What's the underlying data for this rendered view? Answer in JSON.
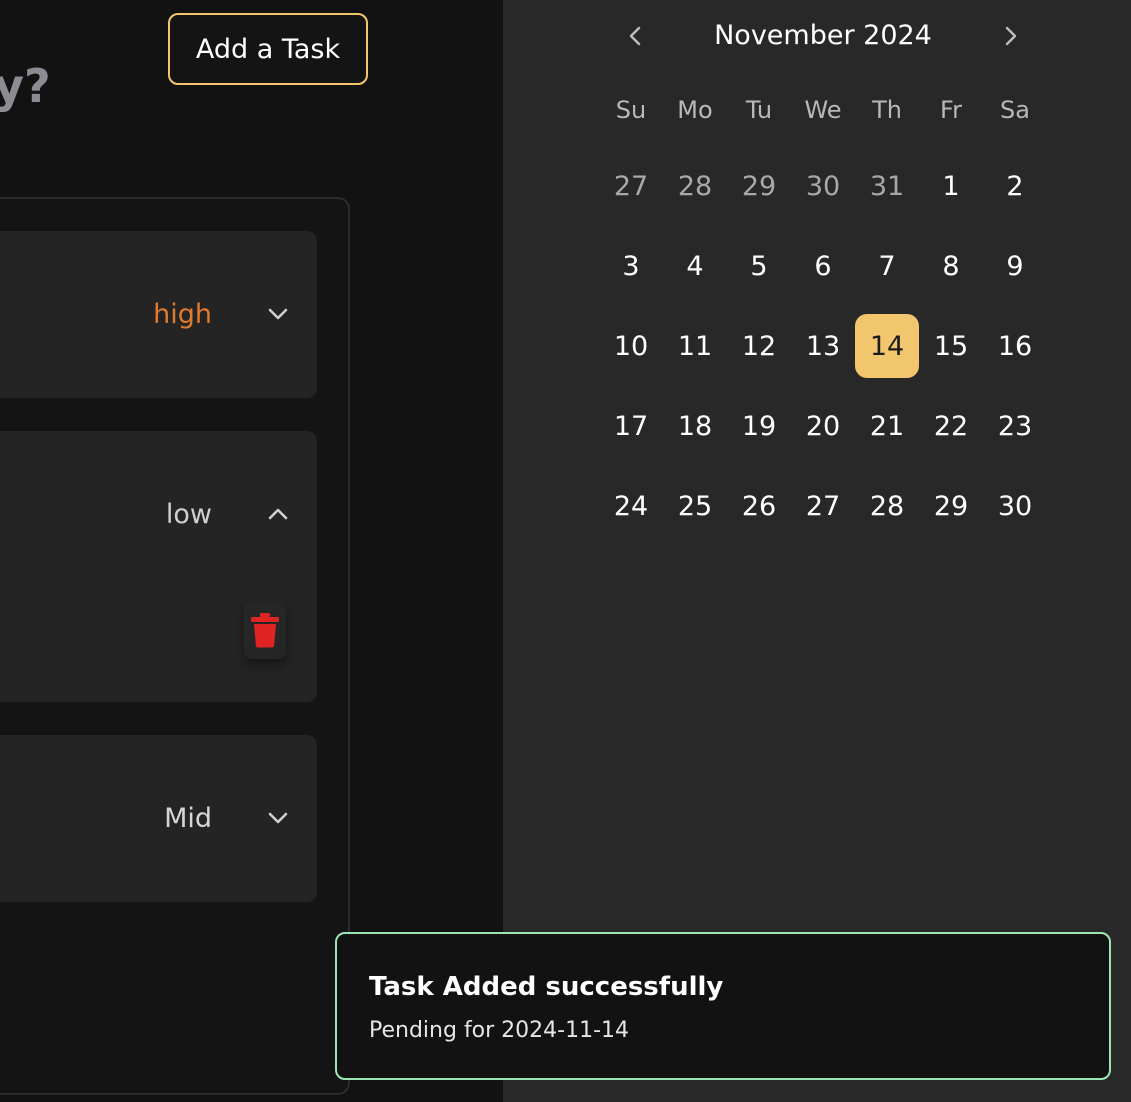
{
  "header": {
    "add_task_label": "Add a Task",
    "heading_fragment": "y?"
  },
  "tasks": [
    {
      "priority": "high",
      "priority_color": "#e07a2c",
      "expanded": false,
      "chevron": "chevron-down-icon"
    },
    {
      "priority": "low",
      "priority_color": "#cfcfcf",
      "expanded": true,
      "chevron": "chevron-up-icon",
      "action_icon": "trash-icon"
    },
    {
      "priority": "Mid",
      "priority_color": "#d6d6d6",
      "expanded": false,
      "chevron": "chevron-down-icon"
    }
  ],
  "calendar": {
    "title": "November 2024",
    "prev_icon": "chevron-left-icon",
    "next_icon": "chevron-right-icon",
    "weekdays": [
      "Su",
      "Mo",
      "Tu",
      "We",
      "Th",
      "Fr",
      "Sa"
    ],
    "weeks": [
      [
        "27",
        "28",
        "29",
        "30",
        "31",
        "1",
        "2"
      ],
      [
        "3",
        "4",
        "5",
        "6",
        "7",
        "8",
        "9"
      ],
      [
        "10",
        "11",
        "12",
        "13",
        "14",
        "15",
        "16"
      ],
      [
        "17",
        "18",
        "19",
        "20",
        "21",
        "22",
        "23"
      ],
      [
        "24",
        "25",
        "26",
        "27",
        "28",
        "29",
        "30"
      ]
    ],
    "outside_days_first_week": 5,
    "selected_day": "14",
    "accent_color": "#f2c66d"
  },
  "toast": {
    "title": "Task Added successfully",
    "subtitle": "Pending for 2024-11-14",
    "border_color": "#9be6b4"
  },
  "colors": {
    "left_background": "#121212",
    "right_background": "#282828",
    "card_background": "#242424",
    "trash_red": "#e02424"
  }
}
